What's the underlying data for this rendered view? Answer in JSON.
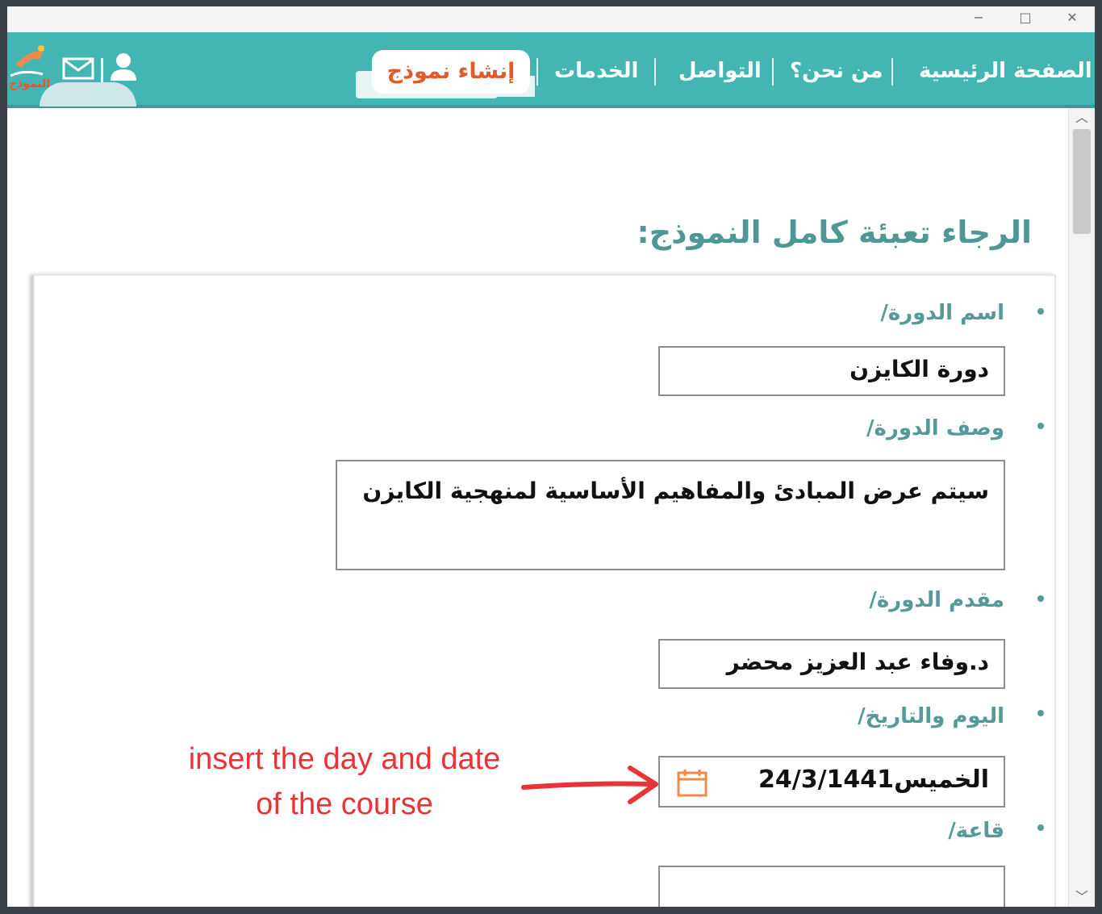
{
  "window": {
    "controls": {
      "minimize": "−",
      "maximize": "□",
      "close": "✕"
    }
  },
  "nav": {
    "items": [
      {
        "label": "الصفحة الرئيسية"
      },
      {
        "label": "من نحن؟"
      },
      {
        "label": "التواصل"
      },
      {
        "label": "الخدمات"
      }
    ],
    "create_form": "إنشاء نموذج",
    "logo_text": "النموذج",
    "icons": [
      "user-icon",
      "mail-icon"
    ],
    "colors": {
      "bar": "#43b6b3",
      "accent": "#e05a2a",
      "label": "#559a97"
    }
  },
  "form": {
    "heading": "الرجاء تعبئة كامل النموذج:",
    "fields": [
      {
        "label": "اسم الدورة/",
        "value": "دورة الكايزن"
      },
      {
        "label": "وصف الدورة/",
        "value": "سيتم عرض المبادئ والمفاهيم الأساسية لمنهجية الكايزن"
      },
      {
        "label": "مقدم الدورة/",
        "value": "د.وفاء عبد العزيز محضر"
      },
      {
        "label": "اليوم والتاريخ/",
        "value": "الخميس24/3/1441"
      },
      {
        "label": "قاعة/",
        "value": ""
      }
    ]
  },
  "annotation": {
    "line1": "insert the day and date",
    "line2": "of the course",
    "color": "#ea3336"
  },
  "scrollbar": {
    "up": "︿",
    "down": "﹀"
  }
}
